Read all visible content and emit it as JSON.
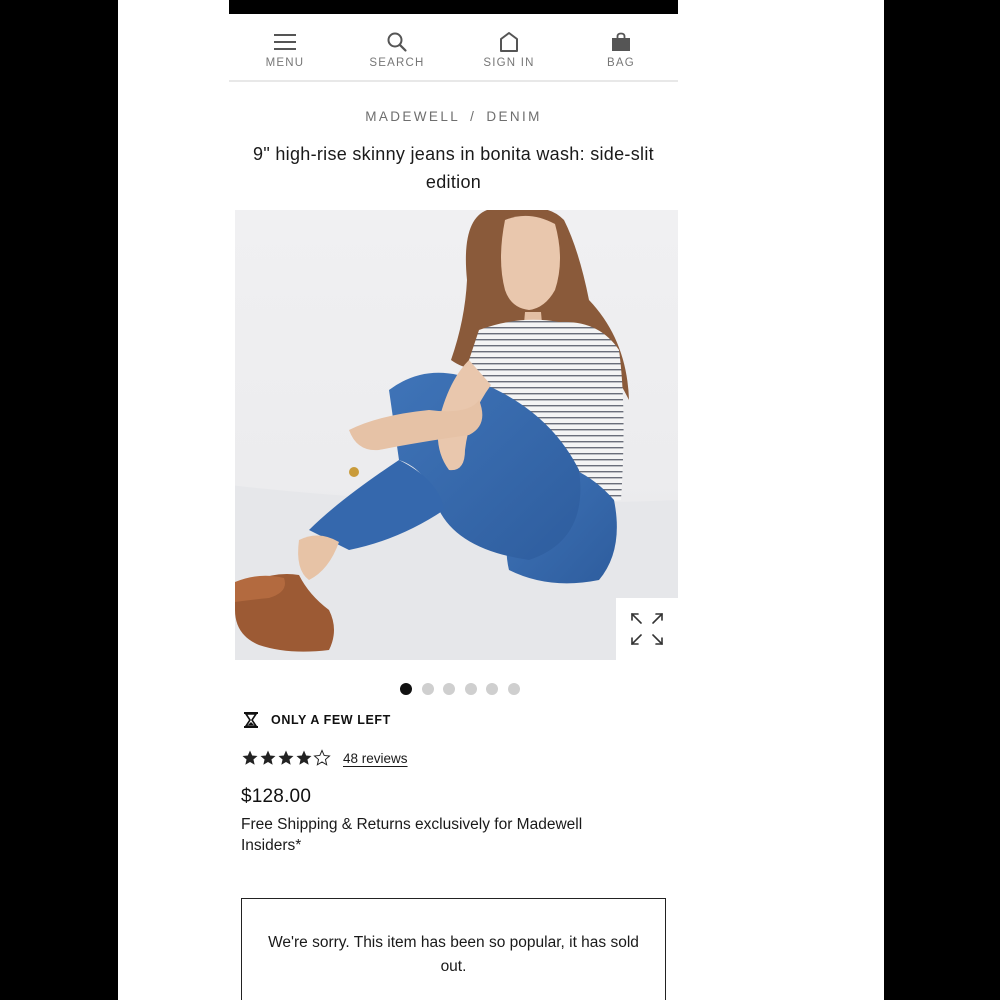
{
  "nav": {
    "menu_label": "MENU",
    "search_label": "SEARCH",
    "signin_label": "SIGN IN",
    "bag_label": "BAG"
  },
  "breadcrumb": {
    "brand": "MADEWELL",
    "separator": "/",
    "category": "DENIM"
  },
  "product": {
    "title": "9\" high-rise skinny jeans in bonita wash: side-slit edition",
    "image_alt": "Model seated wearing high-rise skinny jeans, striped tee and brown loafers",
    "gallery_image_count": 6,
    "gallery_active_index": 0,
    "stock_message": "ONLY A FEW LEFT",
    "rating": 4,
    "rating_max": 5,
    "reviews_label": "48 reviews",
    "price": "$128.00",
    "shipping_note": "Free Shipping & Returns exclusively for Madewell Insiders*",
    "sold_out_message": "We're sorry. This item has been so popular, it has sold out."
  },
  "colors": {
    "frame": "#000000",
    "text": "#1a1a1a",
    "muted": "#777777",
    "dot_active": "#111111",
    "dot_inactive": "#cfcfcf"
  },
  "icons": {
    "menu": "hamburger-icon",
    "search": "search-icon",
    "signin": "user-icon",
    "bag": "shopping-bag-icon",
    "stock": "hourglass-icon",
    "expand": "expand-icon"
  }
}
